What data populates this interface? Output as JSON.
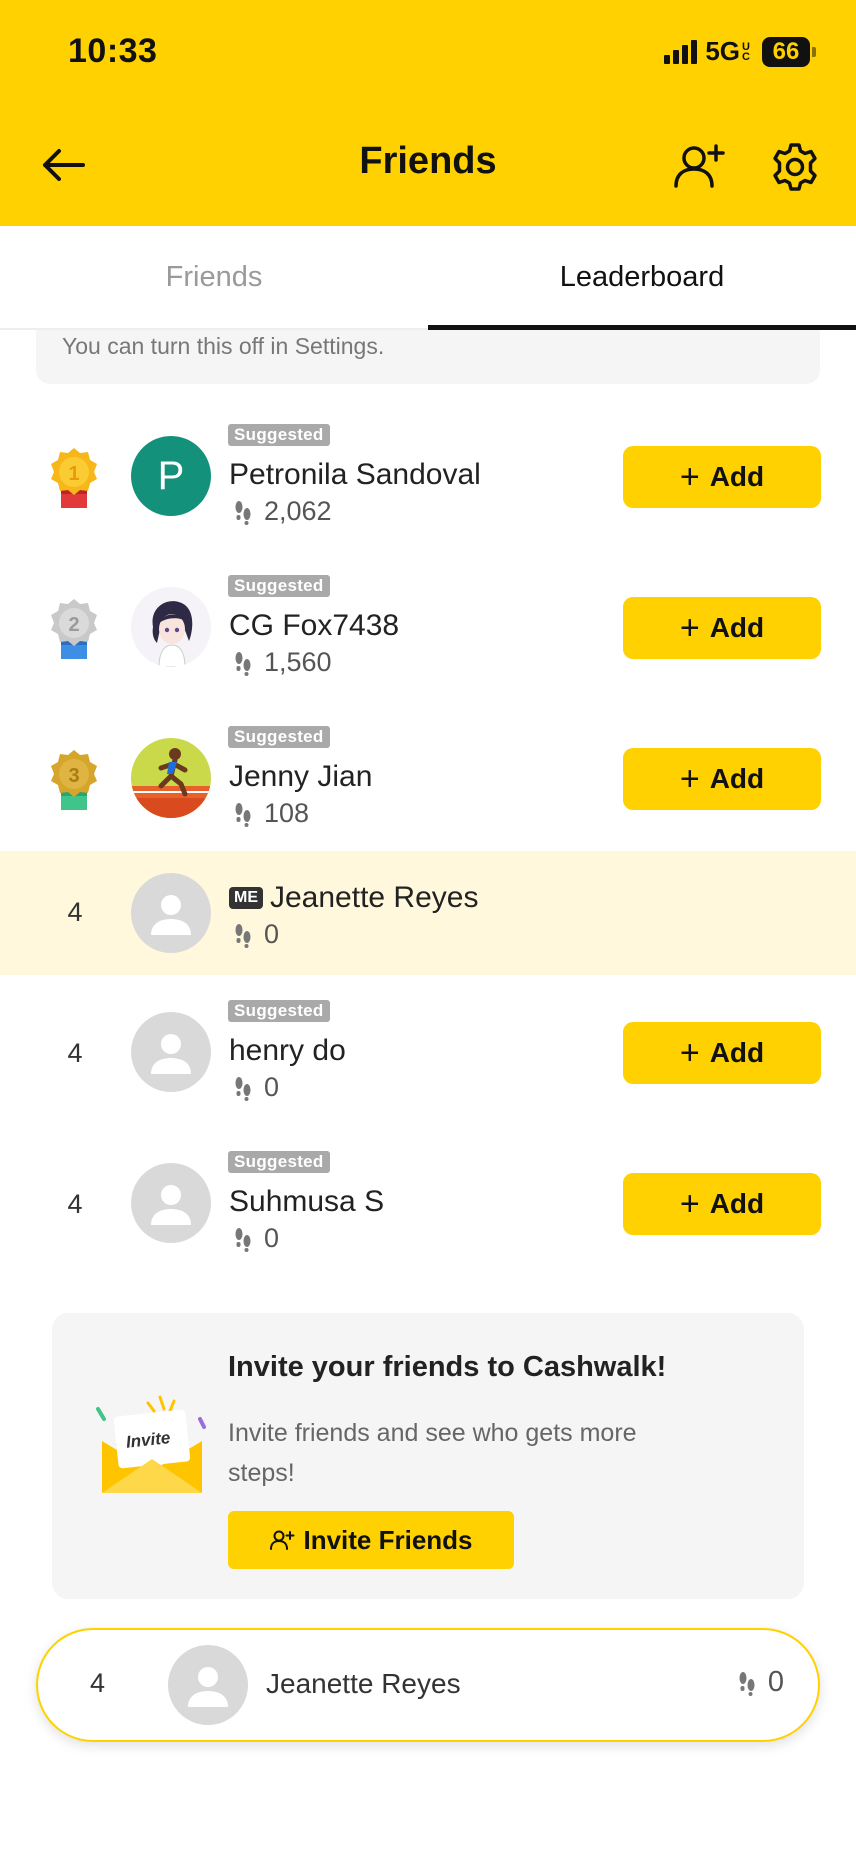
{
  "status_bar": {
    "time": "10:33",
    "network": "5G",
    "network_sup": "UC",
    "battery": "66"
  },
  "header": {
    "title": "Friends"
  },
  "tabs": [
    {
      "label": "Friends",
      "active": false
    },
    {
      "label": "Leaderboard",
      "active": true
    }
  ],
  "notice": {
    "text": "You can turn this off in Settings."
  },
  "leaderboard": [
    {
      "rank": "1",
      "medal": "gold",
      "badge": "Suggested",
      "name": "Petronila Sandoval",
      "steps": "2,062",
      "avatar": "P",
      "action": "Add"
    },
    {
      "rank": "2",
      "medal": "silver",
      "badge": "Suggested",
      "name": "CG Fox7438",
      "steps": "1,560",
      "avatar": "anime-girl",
      "action": "Add"
    },
    {
      "rank": "3",
      "medal": "bronze",
      "badge": "Suggested",
      "name": "Jenny Jian",
      "steps": "108",
      "avatar": "runner",
      "action": "Add"
    },
    {
      "rank": "4",
      "badge": "ME",
      "name": "Jeanette Reyes",
      "steps": "0",
      "avatar": "placeholder"
    },
    {
      "rank": "4",
      "badge": "Suggested",
      "name": "henry do",
      "steps": "0",
      "avatar": "placeholder",
      "action": "Add"
    },
    {
      "rank": "4",
      "badge": "Suggested",
      "name": "Suhmusa S",
      "steps": "0",
      "avatar": "placeholder",
      "action": "Add"
    }
  ],
  "add_label": "Add",
  "invite": {
    "title": "Invite your friends to Cashwalk!",
    "description": "Invite friends and see who gets more steps!",
    "button": "Invite Friends",
    "envelope_text": "Invite"
  },
  "me_bar": {
    "rank": "4",
    "name": "Jeanette Reyes",
    "steps": "0"
  },
  "colors": {
    "brand_yellow": "#FFD100",
    "me_highlight": "#FFF8DD",
    "avatar_green": "#13917b"
  }
}
